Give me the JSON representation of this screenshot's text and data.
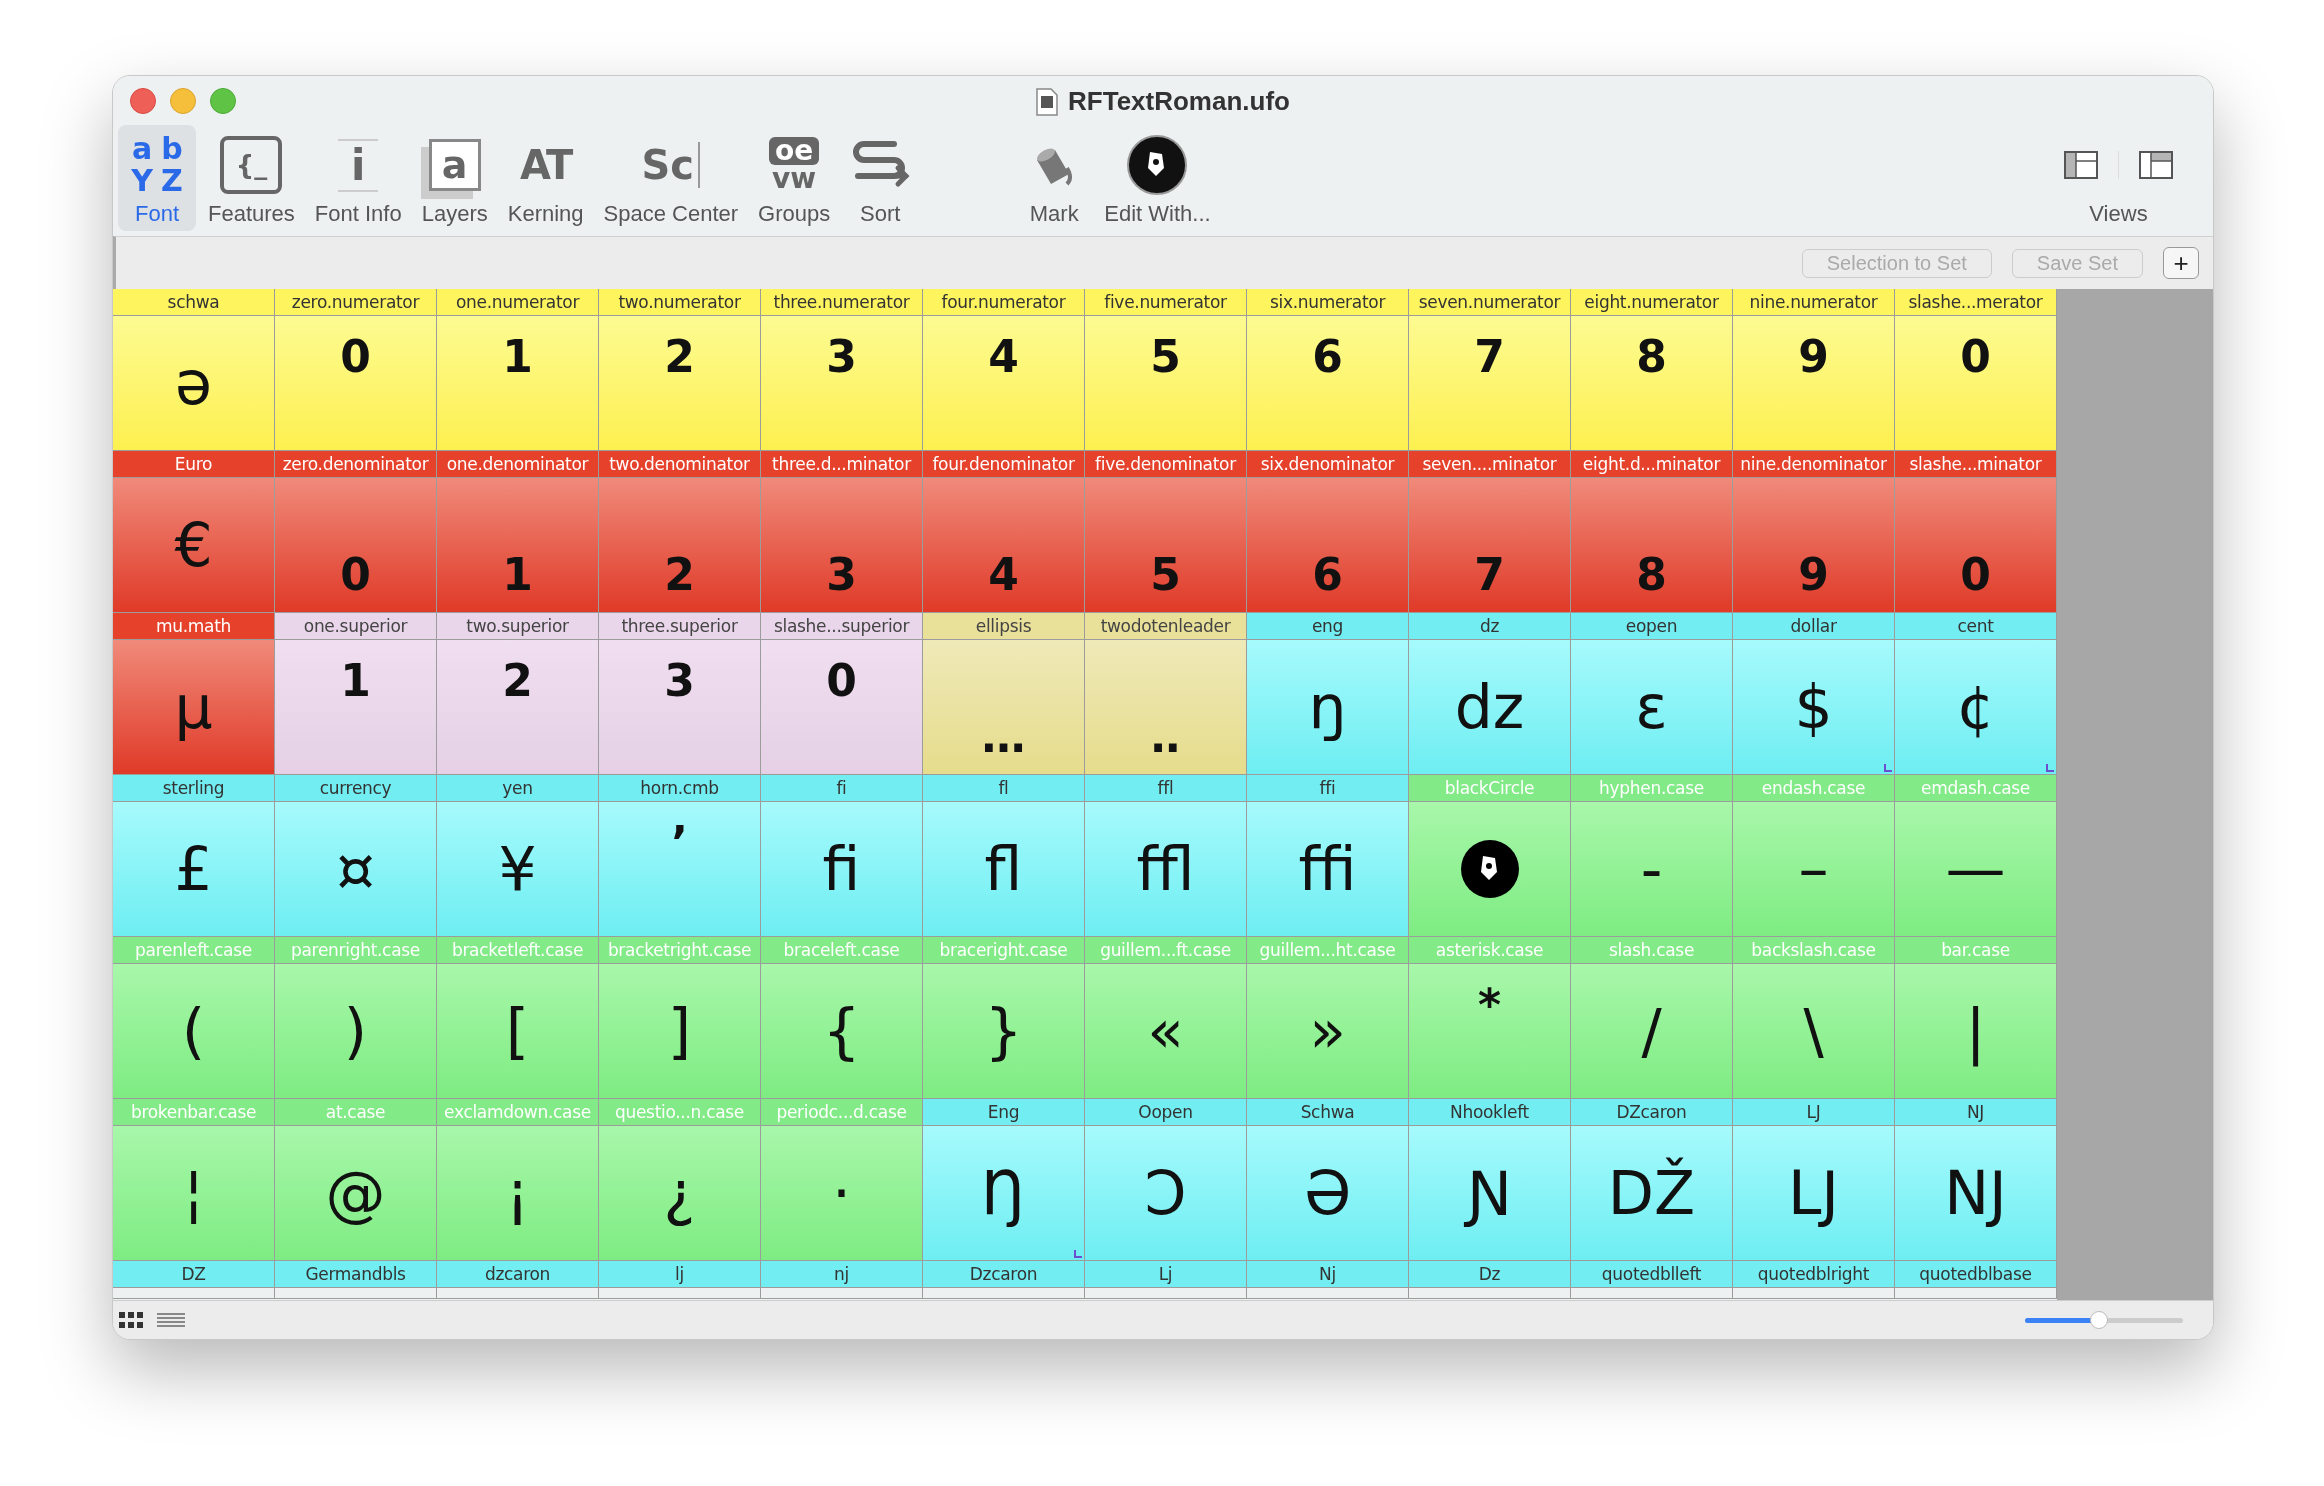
{
  "window": {
    "title": "RFTextRoman.ufo"
  },
  "toolbar": {
    "items": [
      {
        "kind": "font",
        "label": "Font",
        "selected": true,
        "icon_glyphs": [
          "a",
          "b",
          "Y",
          "Z"
        ]
      },
      {
        "kind": "features",
        "label": "Features",
        "selected": false,
        "icon_glyphs": [
          "{_"
        ]
      },
      {
        "kind": "info",
        "label": "Font Info",
        "selected": false,
        "icon_glyphs": [
          "i"
        ]
      },
      {
        "kind": "layers",
        "label": "Layers",
        "selected": false,
        "icon_glyphs": [
          "a"
        ]
      },
      {
        "kind": "kerning",
        "label": "Kerning",
        "selected": false,
        "icon_glyphs": [
          "AT"
        ]
      },
      {
        "kind": "space",
        "label": "Space Center",
        "selected": false,
        "icon_glyphs": [
          "Sc"
        ]
      },
      {
        "kind": "groups",
        "label": "Groups",
        "selected": false,
        "icon_glyphs": [
          "oe",
          "vw"
        ]
      },
      {
        "kind": "sort",
        "label": "Sort",
        "selected": false
      },
      {
        "kind": "mark",
        "label": "Mark",
        "selected": false
      },
      {
        "kind": "edit",
        "label": "Edit With...",
        "selected": false
      }
    ],
    "views_label": "Views"
  },
  "set_bar": {
    "buttons": [
      {
        "label": "Selection to Set",
        "disabled": true
      },
      {
        "label": "Save Set",
        "disabled": true
      }
    ],
    "add_button": "+"
  },
  "grid": {
    "rows": [
      [
        {
          "name": "schwa",
          "glyph": "ə",
          "color": "#fdf45e",
          "kind": "glyph"
        },
        {
          "name": "zero.numerator",
          "glyph": "0",
          "color": "#fdf45e",
          "kind": "raised"
        },
        {
          "name": "one.numerator",
          "glyph": "1",
          "color": "#fdf45e",
          "kind": "raised"
        },
        {
          "name": "two.numerator",
          "glyph": "2",
          "color": "#fdf45e",
          "kind": "raised"
        },
        {
          "name": "three.numerator",
          "glyph": "3",
          "color": "#fdf45e",
          "kind": "raised"
        },
        {
          "name": "four.numerator",
          "glyph": "4",
          "color": "#fdf45e",
          "kind": "raised"
        },
        {
          "name": "five.numerator",
          "glyph": "5",
          "color": "#fdf45e",
          "kind": "raised"
        },
        {
          "name": "six.numerator",
          "glyph": "6",
          "color": "#fdf45e",
          "kind": "raised"
        },
        {
          "name": "seven.numerator",
          "glyph": "7",
          "color": "#fdf45e",
          "kind": "raised"
        },
        {
          "name": "eight.numerator",
          "glyph": "8",
          "color": "#fdf45e",
          "kind": "raised"
        },
        {
          "name": "nine.numerator",
          "glyph": "9",
          "color": "#fdf45e",
          "kind": "raised"
        },
        {
          "name": "slashe...merator",
          "glyph": "0",
          "color": "#fdf45e",
          "kind": "raised"
        }
      ],
      [
        {
          "name": "Euro",
          "glyph": "€",
          "color": "#e5412b",
          "kind": "glyph"
        },
        {
          "name": "zero.denominator",
          "glyph": "0",
          "color": "#e5412b",
          "kind": "lowered"
        },
        {
          "name": "one.denominator",
          "glyph": "1",
          "color": "#e5412b",
          "kind": "lowered"
        },
        {
          "name": "two.denominator",
          "glyph": "2",
          "color": "#e5412b",
          "kind": "lowered"
        },
        {
          "name": "three.d...minator",
          "glyph": "3",
          "color": "#e5412b",
          "kind": "lowered"
        },
        {
          "name": "four.denominator",
          "glyph": "4",
          "color": "#e5412b",
          "kind": "lowered"
        },
        {
          "name": "five.denominator",
          "glyph": "5",
          "color": "#e5412b",
          "kind": "lowered"
        },
        {
          "name": "six.denominator",
          "glyph": "6",
          "color": "#e5412b",
          "kind": "lowered"
        },
        {
          "name": "seven....minator",
          "glyph": "7",
          "color": "#e5412b",
          "kind": "lowered"
        },
        {
          "name": "eight.d...minator",
          "glyph": "8",
          "color": "#e5412b",
          "kind": "lowered"
        },
        {
          "name": "nine.denominator",
          "glyph": "9",
          "color": "#e5412b",
          "kind": "lowered"
        },
        {
          "name": "slashe...minator",
          "glyph": "0",
          "color": "#e5412b",
          "kind": "lowered"
        }
      ],
      [
        {
          "name": "mu.math",
          "glyph": "µ",
          "color": "#e5412b",
          "kind": "glyph"
        },
        {
          "name": "one.superior",
          "glyph": "1",
          "color": "#ead6ea",
          "kind": "raised"
        },
        {
          "name": "two.superior",
          "glyph": "2",
          "color": "#ead6ea",
          "kind": "raised"
        },
        {
          "name": "three.superior",
          "glyph": "3",
          "color": "#ead6ea",
          "kind": "raised"
        },
        {
          "name": "slashe...superior",
          "glyph": "0",
          "color": "#ead6ea",
          "kind": "raised"
        },
        {
          "name": "ellipsis",
          "glyph": "…",
          "color": "#e9e09a",
          "kind": "lowered"
        },
        {
          "name": "twodotenleader",
          "glyph": "‥",
          "color": "#e9e09a",
          "kind": "lowered"
        },
        {
          "name": "eng",
          "glyph": "ŋ",
          "color": "#72eef2",
          "kind": "glyph"
        },
        {
          "name": "dz",
          "glyph": "dz",
          "color": "#72eef2",
          "kind": "glyph"
        },
        {
          "name": "eopen",
          "glyph": "ɛ",
          "color": "#72eef2",
          "kind": "glyph"
        },
        {
          "name": "dollar",
          "glyph": "$",
          "color": "#72eef2",
          "kind": "glyph",
          "flagged": true
        },
        {
          "name": "cent",
          "glyph": "¢",
          "color": "#72eef2",
          "kind": "glyph",
          "flagged": true
        }
      ],
      [
        {
          "name": "sterling",
          "glyph": "£",
          "color": "#72eef2",
          "kind": "glyph"
        },
        {
          "name": "currency",
          "glyph": "¤",
          "color": "#72eef2",
          "kind": "glyph"
        },
        {
          "name": "yen",
          "glyph": "¥",
          "color": "#72eef2",
          "kind": "glyph"
        },
        {
          "name": "horn.cmb",
          "glyph": "ʼ",
          "color": "#72eef2",
          "kind": "raised"
        },
        {
          "name": "fi",
          "glyph": "fi",
          "color": "#72eef2",
          "kind": "glyph"
        },
        {
          "name": "fl",
          "glyph": "fl",
          "color": "#72eef2",
          "kind": "glyph"
        },
        {
          "name": "ffl",
          "glyph": "ffl",
          "color": "#72eef2",
          "kind": "glyph"
        },
        {
          "name": "ffi",
          "glyph": "ffi",
          "color": "#72eef2",
          "kind": "glyph"
        },
        {
          "name": "blackCircle",
          "kind": "icon",
          "color": "#82ea86"
        },
        {
          "name": "hyphen.case",
          "glyph": "-",
          "color": "#82ea86",
          "kind": "glyph"
        },
        {
          "name": "endash.case",
          "glyph": "–",
          "color": "#82ea86",
          "kind": "glyph"
        },
        {
          "name": "emdash.case",
          "glyph": "—",
          "color": "#82ea86",
          "kind": "glyph"
        }
      ],
      [
        {
          "name": "parenleft.case",
          "glyph": "(",
          "color": "#82ea86",
          "kind": "glyph"
        },
        {
          "name": "parenright.case",
          "glyph": ")",
          "color": "#82ea86",
          "kind": "glyph"
        },
        {
          "name": "bracketleft.case",
          "glyph": "[",
          "color": "#82ea86",
          "kind": "glyph"
        },
        {
          "name": "bracketright.case",
          "glyph": "]",
          "color": "#82ea86",
          "kind": "glyph"
        },
        {
          "name": "braceleft.case",
          "glyph": "{",
          "color": "#82ea86",
          "kind": "glyph"
        },
        {
          "name": "braceright.case",
          "glyph": "}",
          "color": "#82ea86",
          "kind": "glyph"
        },
        {
          "name": "guillem...ft.case",
          "glyph": "«",
          "color": "#82ea86",
          "kind": "glyph"
        },
        {
          "name": "guillem...ht.case",
          "glyph": "»",
          "color": "#82ea86",
          "kind": "glyph"
        },
        {
          "name": "asterisk.case",
          "glyph": "*",
          "color": "#82ea86",
          "kind": "raised"
        },
        {
          "name": "slash.case",
          "glyph": "/",
          "color": "#82ea86",
          "kind": "glyph"
        },
        {
          "name": "backslash.case",
          "glyph": "\\",
          "color": "#82ea86",
          "kind": "glyph"
        },
        {
          "name": "bar.case",
          "glyph": "|",
          "color": "#82ea86",
          "kind": "glyph"
        }
      ],
      [
        {
          "name": "brokenbar.case",
          "glyph": "¦",
          "color": "#82ea86",
          "kind": "glyph"
        },
        {
          "name": "at.case",
          "glyph": "@",
          "color": "#82ea86",
          "kind": "glyph"
        },
        {
          "name": "exclamdown.case",
          "glyph": "¡",
          "color": "#82ea86",
          "kind": "glyph"
        },
        {
          "name": "questio...n.case",
          "glyph": "¿",
          "color": "#82ea86",
          "kind": "glyph"
        },
        {
          "name": "periodc...d.case",
          "glyph": "·",
          "color": "#82ea86",
          "kind": "glyph"
        },
        {
          "name": "Eng",
          "glyph": "Ŋ",
          "color": "#72eef2",
          "kind": "glyph",
          "flagged": true
        },
        {
          "name": "Oopen",
          "glyph": "Ɔ",
          "color": "#72eef2",
          "kind": "glyph"
        },
        {
          "name": "Schwa",
          "glyph": "Ə",
          "color": "#72eef2",
          "kind": "glyph"
        },
        {
          "name": "Nhookleft",
          "glyph": "Ɲ",
          "color": "#72eef2",
          "kind": "glyph"
        },
        {
          "name": "DZcaron",
          "glyph": "DŽ",
          "color": "#72eef2",
          "kind": "glyph"
        },
        {
          "name": "LJ",
          "glyph": "LJ",
          "color": "#72eef2",
          "kind": "glyph"
        },
        {
          "name": "NJ",
          "glyph": "NJ",
          "color": "#72eef2",
          "kind": "glyph"
        }
      ],
      [
        {
          "name": "DZ",
          "color": "#72eef2"
        },
        {
          "name": "Germandbls",
          "color": "#72eef2"
        },
        {
          "name": "dzcaron",
          "color": "#72eef2"
        },
        {
          "name": "lj",
          "color": "#72eef2"
        },
        {
          "name": "nj",
          "color": "#72eef2"
        },
        {
          "name": "Dzcaron",
          "color": "#72eef2"
        },
        {
          "name": "Lj",
          "color": "#72eef2"
        },
        {
          "name": "Nj",
          "color": "#72eef2"
        },
        {
          "name": "Dz",
          "color": "#72eef2"
        },
        {
          "name": "quotedblleft",
          "color": "#72eef2"
        },
        {
          "name": "quotedblright",
          "color": "#72eef2"
        },
        {
          "name": "quotedblbase",
          "color": "#72eef2"
        }
      ]
    ]
  },
  "status_bar": {
    "view_buttons": [
      {
        "kind": "grid",
        "selected": true
      },
      {
        "kind": "list",
        "selected": false
      }
    ],
    "zoom": {
      "level": 0.47
    }
  }
}
